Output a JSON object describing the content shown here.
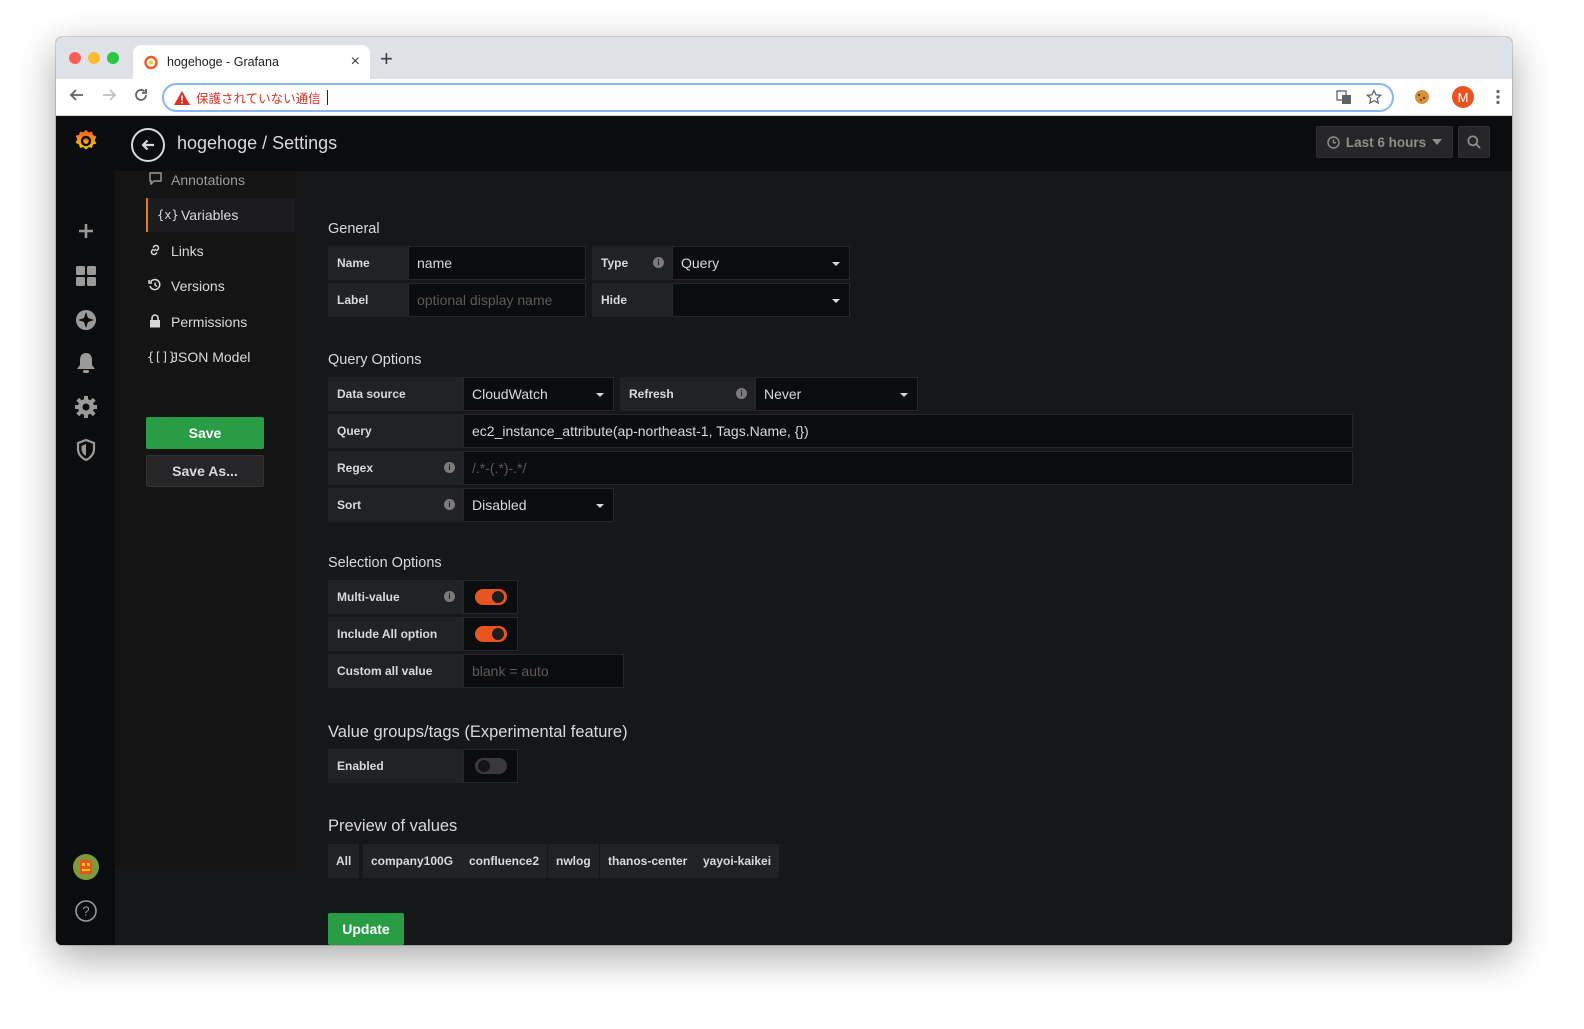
{
  "browser": {
    "tab_title": "hogehoge - Grafana",
    "tab_close": "×",
    "new_tab": "+",
    "url_warning": "保護されていない通信",
    "profile_initial": "M"
  },
  "navbar": {
    "title": "hogehoge / Settings",
    "time_range": "Last 6 hours"
  },
  "settings_nav": {
    "items": [
      {
        "label": "Annotations",
        "icon": "annotation-icon"
      },
      {
        "label": "Variables",
        "icon": "variables-icon",
        "active": true
      },
      {
        "label": "Links",
        "icon": "link-icon"
      },
      {
        "label": "Versions",
        "icon": "history-icon"
      },
      {
        "label": "Permissions",
        "icon": "lock-icon"
      },
      {
        "label": "JSON Model",
        "icon": "json-icon"
      }
    ],
    "save_label": "Save",
    "save_as_label": "Save As..."
  },
  "general": {
    "title": "General",
    "name_label": "Name",
    "name_value": "name",
    "type_label": "Type",
    "type_value": "Query",
    "label_label": "Label",
    "label_placeholder": "optional display name",
    "hide_label": "Hide",
    "hide_value": ""
  },
  "query_options": {
    "title": "Query Options",
    "datasource_label": "Data source",
    "datasource_value": "CloudWatch",
    "refresh_label": "Refresh",
    "refresh_value": "Never",
    "query_label": "Query",
    "query_value": "ec2_instance_attribute(ap-northeast-1, Tags.Name, {})",
    "regex_label": "Regex",
    "regex_placeholder": "/.*-(.*)-.*/",
    "sort_label": "Sort",
    "sort_value": "Disabled"
  },
  "selection_options": {
    "title": "Selection Options",
    "multi_value_label": "Multi-value",
    "multi_value": true,
    "include_all_label": "Include All option",
    "include_all": true,
    "custom_all_label": "Custom all value",
    "custom_all_placeholder": "blank = auto"
  },
  "value_groups": {
    "title": "Value groups/tags (Experimental feature)",
    "enabled_label": "Enabled",
    "enabled": false
  },
  "preview": {
    "title": "Preview of values",
    "values": [
      "All",
      "company100G",
      "confluence2",
      "nwlog",
      "thanos-center",
      "yayoi-kaikei"
    ]
  },
  "update_label": "Update",
  "colors": {
    "accent_orange": "#eb7b18",
    "primary_green": "#299c46",
    "switch_on": "#e8541f"
  }
}
